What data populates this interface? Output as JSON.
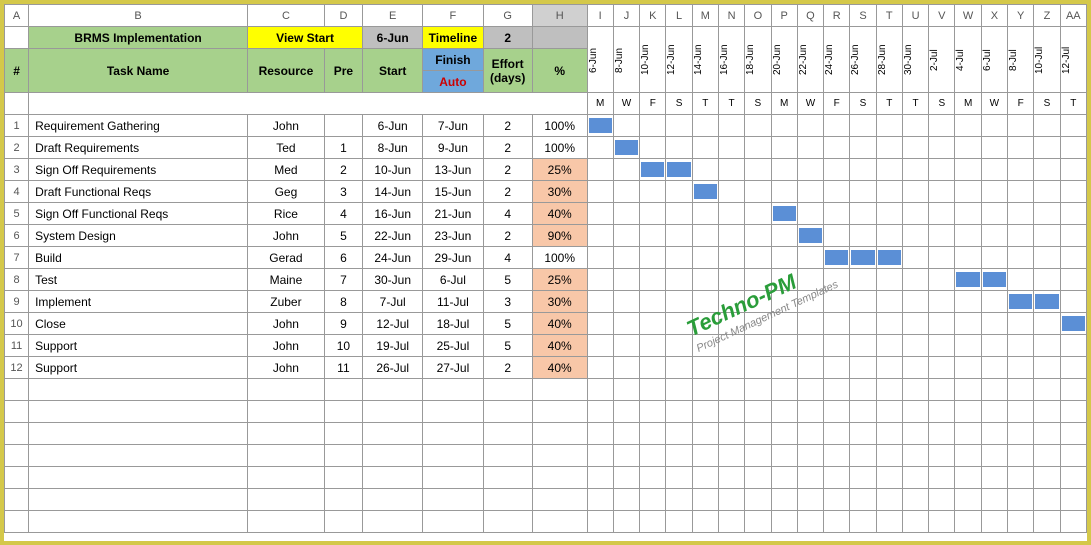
{
  "cols": [
    "A",
    "B",
    "C",
    "D",
    "E",
    "F",
    "G",
    "H",
    "I",
    "J",
    "K",
    "L",
    "M",
    "N",
    "O",
    "P",
    "Q",
    "R",
    "S",
    "T",
    "U",
    "V",
    "W",
    "X",
    "Y",
    "Z",
    "AA"
  ],
  "title": "BRMS Implementation",
  "view_start_label": "View Start",
  "view_start_date": "6-Jun",
  "timeline_label": "Timeline",
  "timeline_val": "2",
  "hdr": {
    "num": "#",
    "task": "Task Name",
    "resource": "Resource",
    "pre": "Pre",
    "start": "Start",
    "finish": "Finish",
    "auto": "Auto",
    "effort": "Effort (days)",
    "pct": "%"
  },
  "dates": [
    "6-Jun",
    "8-Jun",
    "10-Jun",
    "12-Jun",
    "14-Jun",
    "16-Jun",
    "18-Jun",
    "20-Jun",
    "22-Jun",
    "24-Jun",
    "26-Jun",
    "28-Jun",
    "30-Jun",
    "2-Jul",
    "4-Jul",
    "6-Jul",
    "8-Jul",
    "10-Jul",
    "12-Jul"
  ],
  "days": [
    "M",
    "W",
    "F",
    "S",
    "T",
    "T",
    "S",
    "M",
    "W",
    "F",
    "S",
    "T",
    "T",
    "S",
    "M",
    "W",
    "F",
    "S",
    "T"
  ],
  "tasks": [
    {
      "n": 1,
      "name": "Requirement Gathering",
      "res": "John",
      "pre": "",
      "start": "6-Jun",
      "finish": "7-Jun",
      "effort": 2,
      "pct": "100%",
      "shade": false,
      "bar": [
        0
      ]
    },
    {
      "n": 2,
      "name": "Draft  Requirements",
      "res": "Ted",
      "pre": "1",
      "start": "8-Jun",
      "finish": "9-Jun",
      "effort": 2,
      "pct": "100%",
      "shade": false,
      "bar": [
        1
      ]
    },
    {
      "n": 3,
      "name": "Sign Off  Requirements",
      "res": "Med",
      "pre": "2",
      "start": "10-Jun",
      "finish": "13-Jun",
      "effort": 2,
      "pct": "25%",
      "shade": true,
      "bar": [
        2,
        3
      ]
    },
    {
      "n": 4,
      "name": "Draft Functional Reqs",
      "res": "Geg",
      "pre": "3",
      "start": "14-Jun",
      "finish": "15-Jun",
      "effort": 2,
      "pct": "30%",
      "shade": true,
      "bar": [
        4
      ]
    },
    {
      "n": 5,
      "name": "Sign Off Functional Reqs",
      "res": "Rice",
      "pre": "4",
      "start": "16-Jun",
      "finish": "21-Jun",
      "effort": 4,
      "pct": "40%",
      "shade": true,
      "bar": [
        7
      ]
    },
    {
      "n": 6,
      "name": "System Design",
      "res": "John",
      "pre": "5",
      "start": "22-Jun",
      "finish": "23-Jun",
      "effort": 2,
      "pct": "90%",
      "shade": true,
      "bar": [
        8
      ]
    },
    {
      "n": 7,
      "name": "Build",
      "res": "Gerad",
      "pre": "6",
      "start": "24-Jun",
      "finish": "29-Jun",
      "effort": 4,
      "pct": "100%",
      "shade": false,
      "bar": [
        9,
        10,
        11
      ]
    },
    {
      "n": 8,
      "name": "Test",
      "res": "Maine",
      "pre": "7",
      "start": "30-Jun",
      "finish": "6-Jul",
      "effort": 5,
      "pct": "25%",
      "shade": true,
      "bar": [
        14,
        15
      ]
    },
    {
      "n": 9,
      "name": "Implement",
      "res": "Zuber",
      "pre": "8",
      "start": "7-Jul",
      "finish": "11-Jul",
      "effort": 3,
      "pct": "30%",
      "shade": true,
      "bar": [
        16,
        17
      ]
    },
    {
      "n": 10,
      "name": "Close",
      "res": "John",
      "pre": "9",
      "start": "12-Jul",
      "finish": "18-Jul",
      "effort": 5,
      "pct": "40%",
      "shade": true,
      "bar": [
        18
      ]
    },
    {
      "n": 11,
      "name": "Support",
      "res": "John",
      "pre": "10",
      "start": "19-Jul",
      "finish": "25-Jul",
      "effort": 5,
      "pct": "40%",
      "shade": true,
      "bar": []
    },
    {
      "n": 12,
      "name": "Support",
      "res": "John",
      "pre": "11",
      "start": "26-Jul",
      "finish": "27-Jul",
      "effort": 2,
      "pct": "40%",
      "shade": true,
      "bar": []
    }
  ],
  "watermark": {
    "title": "Techno-PM",
    "sub": "Project Management Templates"
  }
}
